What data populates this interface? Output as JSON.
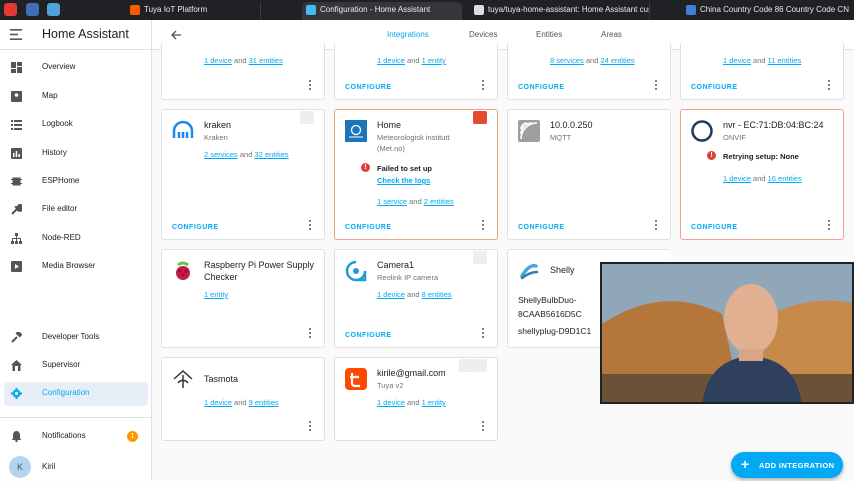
{
  "browser": {
    "tabs": [
      {
        "label": "Tuya IoT Platform",
        "active": false
      },
      {
        "label": "Configuration - Home Assistant",
        "active": true
      },
      {
        "label": "tuya/tuya-home-assistant: Home Assistant custo...",
        "active": false
      },
      {
        "label": "China Country Code 86 Country Code CN",
        "active": false
      }
    ]
  },
  "sidebar": {
    "title": "Home Assistant",
    "items": [
      {
        "label": "Overview",
        "icon": "dashboard-icon"
      },
      {
        "label": "Map",
        "icon": "map-icon"
      },
      {
        "label": "Logbook",
        "icon": "logbook-icon"
      },
      {
        "label": "History",
        "icon": "history-icon"
      },
      {
        "label": "ESPHome",
        "icon": "esphome-icon"
      },
      {
        "label": "File editor",
        "icon": "wrench-icon"
      },
      {
        "label": "Node-RED",
        "icon": "sitemap-icon"
      },
      {
        "label": "Media Browser",
        "icon": "media-icon"
      }
    ],
    "bottom_items": [
      {
        "label": "Developer Tools",
        "icon": "hammer-icon"
      },
      {
        "label": "Supervisor",
        "icon": "supervisor-icon"
      },
      {
        "label": "Configuration",
        "icon": "gear-icon"
      }
    ],
    "notifications": {
      "label": "Notifications",
      "count": "1"
    },
    "user": {
      "name": "Kiril",
      "initial": "K"
    }
  },
  "header": {
    "tabs": [
      "Integrations",
      "Devices",
      "Entities",
      "Areas"
    ],
    "active_tab": "Integrations"
  },
  "top_row": [
    {
      "a": "1 device",
      "mid": " and ",
      "b": "31 entities"
    },
    {
      "a": "1 device",
      "mid": " and ",
      "b": "1 entity"
    },
    {
      "a": "8 services",
      "mid": " and ",
      "b": "24 entities"
    },
    {
      "a": "1 device",
      "mid": " and ",
      "b": "11 entities"
    }
  ],
  "cards": {
    "kraken": {
      "title": "kraken",
      "sub": "Kraken",
      "a": "2 services",
      "mid": " and ",
      "b": "32 entities",
      "configure": "CONFIGURE"
    },
    "home": {
      "title": "Home",
      "sub": "Meteorologisk institutt",
      "sub2": "(Met.no)",
      "error": "Failed to set up",
      "error_link": "Check the logs",
      "a": "1 service",
      "mid": " and ",
      "b": "2 entities",
      "configure": "CONFIGURE"
    },
    "mqtt": {
      "title": "10.0.0.250",
      "sub": "MQTT",
      "configure": "CONFIGURE"
    },
    "nvr": {
      "title": "nvr - EC:71:DB:04:BC:24",
      "sub": "ONVIF",
      "error": "Retrying setup: None",
      "a": "1 device",
      "mid": " and ",
      "b": "16 entities",
      "configure": "CONFIGURE"
    },
    "rpi": {
      "title": "Raspberry Pi Power Supply",
      "title2": "Checker",
      "a": "1 entity"
    },
    "camera": {
      "title": "Camera1",
      "sub": "Reolink IP camera",
      "a": "1 device",
      "mid": " and ",
      "b": "8 entities",
      "configure": "CONFIGURE"
    },
    "shelly": {
      "title": "Shelly",
      "item1": "ShellyBulbDuo-",
      "item1b": "8CAAB5616D5C",
      "item2": "shellyplug-D9D1C1"
    },
    "tasmota": {
      "title": "Tasmota",
      "a": "1 device",
      "mid": " and ",
      "b": "9 entities"
    },
    "tuya": {
      "title": "kirile@gmail.com",
      "sub": "Tuya v2",
      "a": "1 device",
      "mid": " and ",
      "b": "1 entity"
    }
  },
  "fab": {
    "label": "ADD INTEGRATION"
  },
  "colors": {
    "accent": "#03a9f4",
    "error": "#db4437",
    "badge": "#ff9800"
  }
}
